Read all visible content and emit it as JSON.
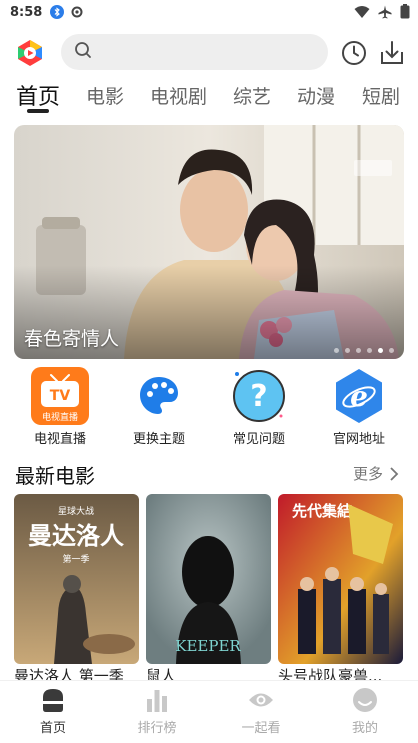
{
  "status_bar": {
    "time": "8:58"
  },
  "search": {
    "placeholder": ""
  },
  "tabs": [
    {
      "label": "首页"
    },
    {
      "label": "电影"
    },
    {
      "label": "电视剧"
    },
    {
      "label": "综艺"
    },
    {
      "label": "动漫"
    },
    {
      "label": "短剧"
    }
  ],
  "banner": {
    "title": "春色寄情人",
    "total_slides": 6,
    "active_slide": 5
  },
  "shortcuts": [
    {
      "label": "电视直播",
      "icon": "tv-live-icon",
      "badge": "电视直播"
    },
    {
      "label": "更换主题",
      "icon": "palette-icon"
    },
    {
      "label": "常见问题",
      "icon": "question-icon"
    },
    {
      "label": "官网地址",
      "icon": "browser-icon"
    }
  ],
  "section": {
    "title": "最新电影",
    "more": "更多"
  },
  "movies": [
    {
      "title": "曼达洛人 第一季",
      "poster_text": "曼达洛人",
      "poster_sub": "第一季",
      "poster_top": "星球大战"
    },
    {
      "title": "鼠人",
      "poster_text": "KEEPER"
    },
    {
      "title": "头号战队豪兽...",
      "poster_text": "先代集結"
    }
  ],
  "bottom_nav": [
    {
      "label": "首页",
      "icon": "home-icon",
      "active": true
    },
    {
      "label": "排行榜",
      "icon": "ranking-icon"
    },
    {
      "label": "一起看",
      "icon": "eye-icon"
    },
    {
      "label": "我的",
      "icon": "profile-icon"
    }
  ],
  "colors": {
    "accent": "#ff7b1a",
    "text": "#222222",
    "muted": "#999999",
    "search_bg": "#eeeeee"
  }
}
